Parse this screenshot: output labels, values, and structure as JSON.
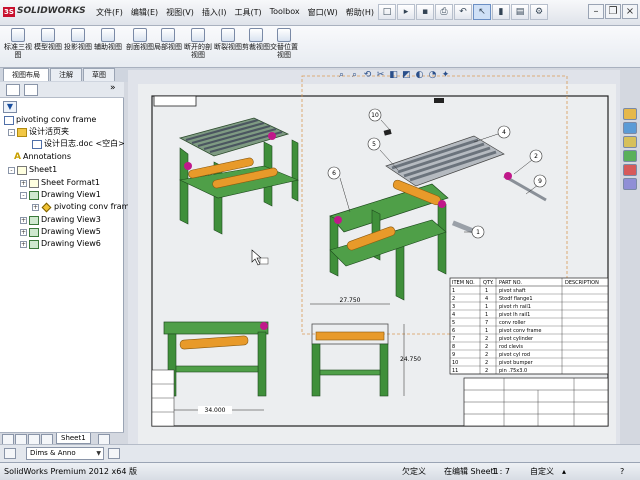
{
  "app": {
    "brand": "SOLIDWORKS",
    "status_product": "SolidWorks Premium 2012 x64 版"
  },
  "menu": [
    "文件(F)",
    "编辑(E)",
    "视图(V)",
    "插入(I)",
    "工具(T)",
    "Toolbox",
    "窗口(W)",
    "帮助(H)"
  ],
  "command_buttons": [
    "标准三视图",
    "模型视图",
    "投影视图",
    "辅助视图",
    "剖面视图",
    "局部视图",
    "断开的剖视图",
    "断裂视图",
    "剪裁视图",
    "交替位置视图"
  ],
  "command_tabs": [
    "视图布局",
    "注解",
    "草图"
  ],
  "tree": {
    "root": "pivoting conv frame",
    "design_binder": "设计活页夹",
    "design_log": "设计日志.doc <空白>",
    "annotations": "Annotations",
    "sheet": "Sheet1",
    "sheet_format": "Sheet Format1",
    "view1": "Drawing View1",
    "view1_part": "pivoting conv frame",
    "view3": "Drawing View3",
    "view5": "Drawing View5",
    "view6": "Drawing View6"
  },
  "sheet_tab": "Sheet1",
  "config_combo": "Dims & Anno",
  "status": {
    "underdefined": "欠定义",
    "editing": "在编辑 Sheet1",
    "scale": "1 : 7",
    "custom": "自定义"
  },
  "drawing": {
    "dim_overall_length": "34.000",
    "dim_end_width": "27.750",
    "dim_end_height": "24.750",
    "balloons": [
      "10",
      "4",
      "5",
      "2",
      "6",
      "9",
      "1"
    ]
  },
  "bom": {
    "headers": [
      "ITEM NO.",
      "QTY.",
      "PART NO.",
      "DESCRIPTION"
    ],
    "rows": [
      [
        "1",
        "1",
        "pivot shaft",
        ""
      ],
      [
        "2",
        "4",
        "Stodf flange1",
        ""
      ],
      [
        "3",
        "1",
        "pivot rh rail1",
        ""
      ],
      [
        "4",
        "1",
        "pivot lh rail1",
        ""
      ],
      [
        "5",
        "7",
        "conv roller",
        ""
      ],
      [
        "6",
        "1",
        "pivot conv frame",
        ""
      ],
      [
        "7",
        "2",
        "pivot cylinder",
        ""
      ],
      [
        "8",
        "2",
        "rod clevis",
        ""
      ],
      [
        "9",
        "2",
        "pivot cyl rod",
        ""
      ],
      [
        "10",
        "2",
        "pivot bumper",
        ""
      ],
      [
        "11",
        "2",
        "pin .75x3.0",
        ""
      ]
    ]
  },
  "colors": {
    "frame": "#3f8f3a",
    "cylinder": "#e89a2a",
    "clevis": "#c0188a",
    "roller": "#9aa0a8",
    "selection": "#e0a060"
  }
}
